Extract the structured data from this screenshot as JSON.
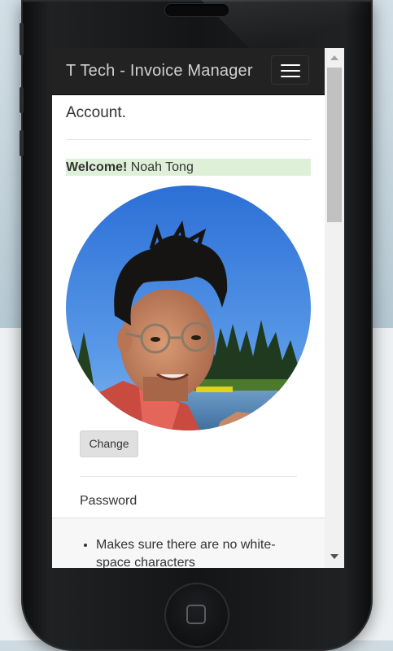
{
  "app": {
    "title": "T Tech - Invoice Manager"
  },
  "page": {
    "heading": "Account."
  },
  "welcome": {
    "label": "Welcome!",
    "name": "Noah Tong"
  },
  "profile": {
    "change_label": "Change"
  },
  "password": {
    "label": "Password",
    "rules": [
      "Makes sure there are no white-space characters"
    ]
  },
  "icons": {
    "menu": "hamburger-icon",
    "home": "home-button-icon"
  },
  "colors": {
    "navbar": "#222222",
    "welcome_bg": "#dff0d8",
    "button_bg": "#e0e0e0"
  }
}
